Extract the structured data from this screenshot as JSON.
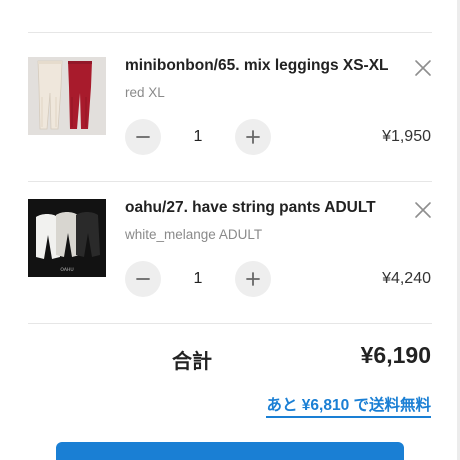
{
  "cart": {
    "items": [
      {
        "title": "minibonbon/65. mix leggings XS-XL",
        "variant": "red XL",
        "quantity": "1",
        "price": "¥1,950",
        "thumbnail_icon": "leggings-photo",
        "thumbnail_colors": {
          "background": "#d9d6d3",
          "left_garment": "#efe7dc",
          "right_garment": "#a81b2c"
        }
      },
      {
        "title": "oahu/27. have string pants ADULT",
        "variant": "white_melange ADULT",
        "quantity": "1",
        "price": "¥4,240",
        "thumbnail_icon": "pants-photo",
        "thumbnail_colors": {
          "background": "#121212",
          "left_garment": "#f1f1ef",
          "mid_garment": "#d8d6d0",
          "right_garment": "#2a2a2a"
        },
        "thumbnail_text": "OAHU"
      }
    ],
    "remove_icon": "close-icon",
    "minus_icon": "minus-icon",
    "plus_icon": "plus-icon"
  },
  "summary": {
    "total_label": "合計",
    "total_value": "¥6,190",
    "free_shipping_text": "あと ¥6,810 で送料無料"
  },
  "colors": {
    "accent": "#1a7fd4",
    "divider": "#e6e6e6",
    "stepper_bg": "#eeeeee",
    "muted_text": "#8a8a8a"
  }
}
